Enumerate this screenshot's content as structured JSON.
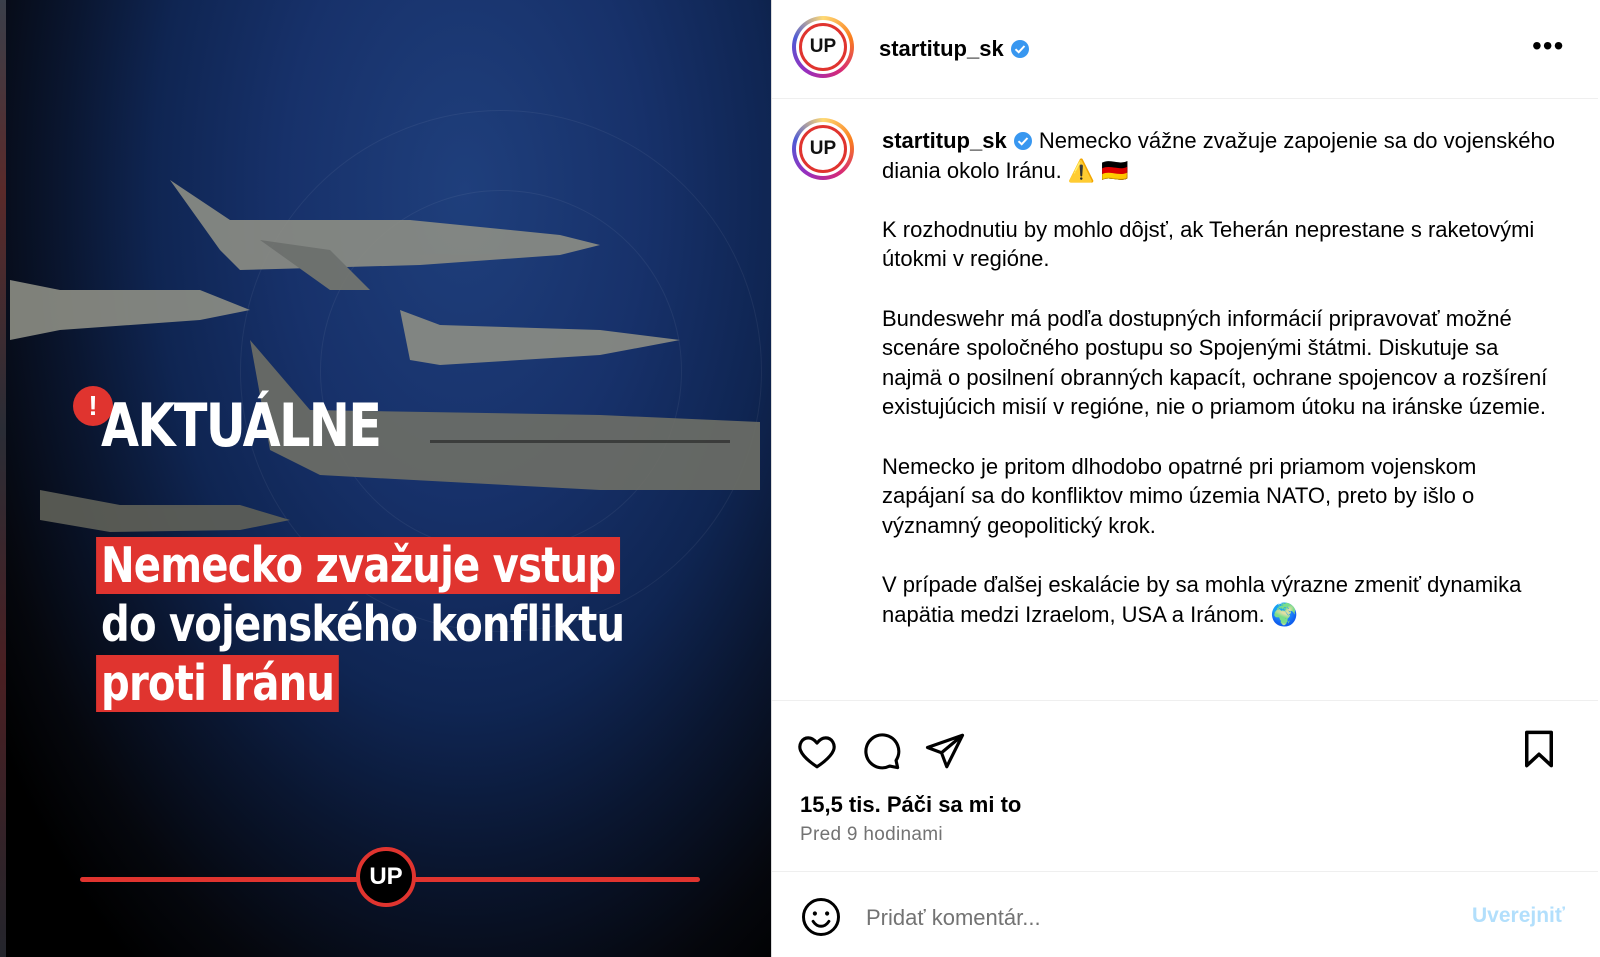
{
  "media": {
    "kicker": "AKTUÁLNE",
    "alert_mark": "!",
    "headline": {
      "line1": "Nemecko zvažuje vstup",
      "line2": "do vojenského konfliktu",
      "line3": "proti Iránu"
    },
    "brand_logo_text": "UP",
    "accent_color": "#e0342f"
  },
  "post": {
    "username": "startitup_sk",
    "avatar_text": "UP",
    "more_icon": "more-horizontal-icon",
    "caption": {
      "username": "startitup_sk",
      "p1": "Nemecko vážne zvažuje zapojenie sa do vojenského diania okolo Iránu. ⚠️ 🇩🇪",
      "p2": "K rozhodnutiu by mohlo dôjsť, ak Teherán neprestane s raketovými útokmi v regióne.",
      "p3": "Bundeswehr má podľa dostupných informácií pripravovať možné scenáre spoločného postupu so Spojenými štátmi. Diskutuje sa najmä o posilnení obranných kapacít, ochrane spojencov a rozšírení existujúcich misií v regióne, nie o priamom útoku na iránske územie.",
      "p4": "Nemecko je pritom dlhodobo opatrné pri priamom vojenskom zapájaní sa do konfliktov mimo územia NATO, preto by išlo o významný geopolitický krok.",
      "p5": "V prípade ďalšej eskalácie by sa mohla výrazne zmeniť dynamika napätia medzi Izraelom, USA a Iránom. 🌍"
    },
    "likes": "15,5 tis. Páči sa mi to",
    "time": "Pred 9 hodinami",
    "comment_placeholder": "Pridať komentár...",
    "post_button": "Uverejniť",
    "verified_color": "#3897f0"
  }
}
